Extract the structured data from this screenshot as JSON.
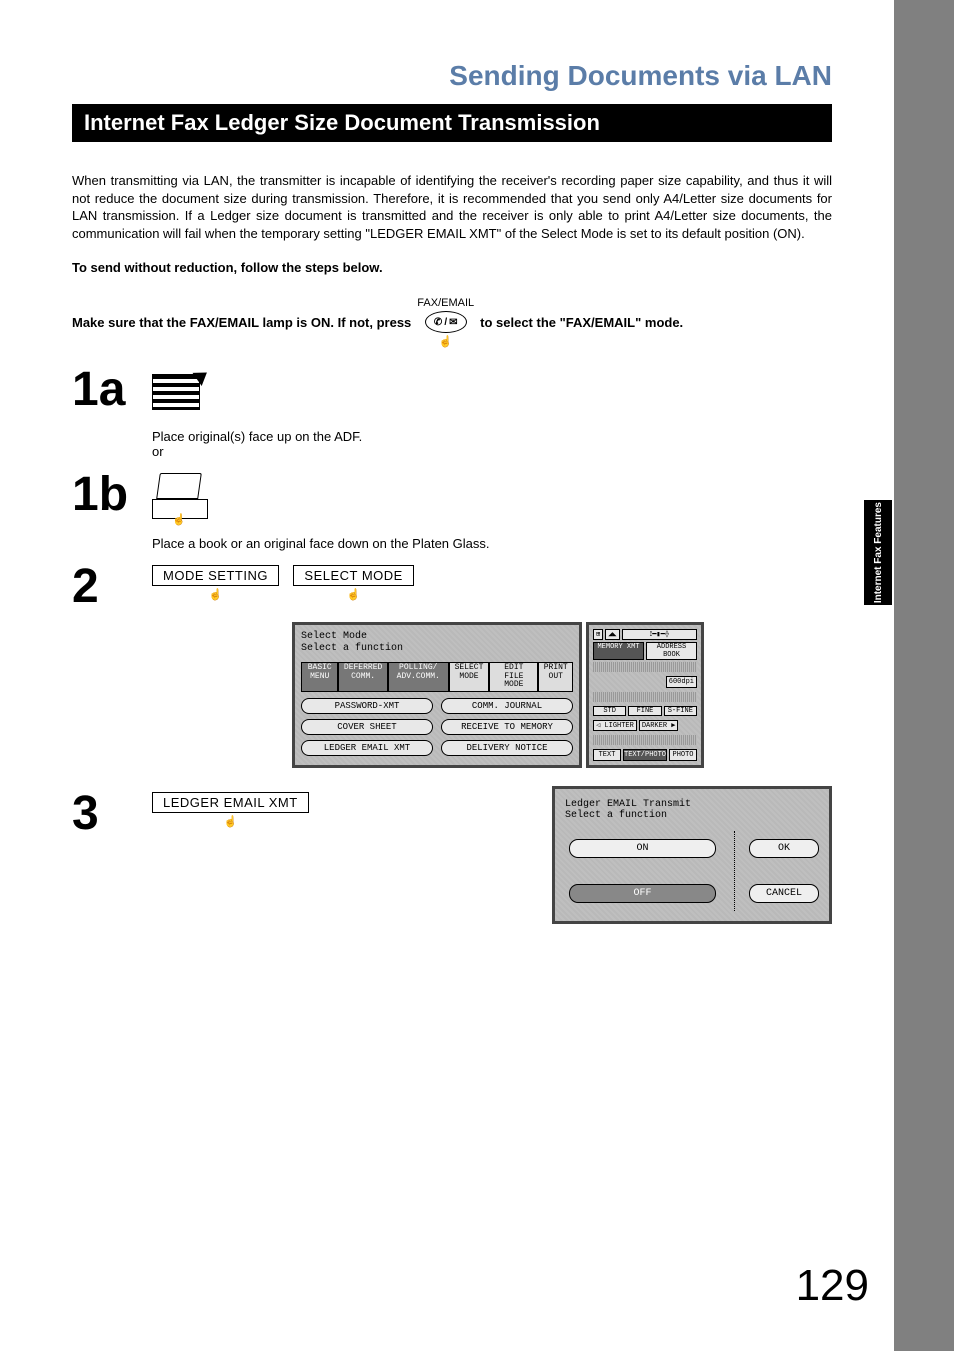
{
  "page_title": "Sending Documents via LAN",
  "section_heading": "Internet Fax Ledger Size Document Transmission",
  "side_tab": "Internet Fax\nFeatures",
  "page_number": "129",
  "intro_paragraph": "When transmitting via LAN, the transmitter is incapable of identifying the receiver's recording paper size capability, and thus it will not reduce the document size during transmission.  Therefore, it is recommended that you send only A4/Letter size documents for LAN transmission.  If a Ledger size document is transmitted and the receiver is only able to print A4/Letter size documents, the communication will fail when the temporary setting  \"LEDGER EMAIL XMT\" of the Select Mode is set to its default position (ON).",
  "bold_instruction": "To send without reduction, follow the steps below.",
  "lamp_line_pre": "Make sure that the FAX/EMAIL lamp is ON.  If not, press",
  "lamp_line_post": "to select the \"FAX/EMAIL\" mode.",
  "fax_email_label": "FAX/EMAIL",
  "steps": {
    "s1a": {
      "num": "1a",
      "text": "Place original(s) face up on the ADF.",
      "or": "or"
    },
    "s1b": {
      "num": "1b",
      "text": "Place a book or an original face down on the Platen Glass."
    },
    "s2": {
      "num": "2",
      "btn1": "MODE SETTING",
      "btn2": "SELECT MODE",
      "screen": {
        "title1": "Select Mode",
        "title2": "Select a function",
        "tabs": [
          "BASIC MENU",
          "DEFERRED COMM.",
          "POLLING/ ADV.COMM.",
          "SELECT MODE",
          "EDIT FILE MODE",
          "PRINT OUT"
        ],
        "buttons": [
          "PASSWORD-XMT",
          "COMM. JOURNAL",
          "COVER SHEET",
          "RECEIVE TO MEMORY",
          "LEDGER EMAIL XMT",
          "DELIVERY NOTICE"
        ],
        "side_top": [
          "MEMORY XMT",
          "ADDRESS BOOK"
        ],
        "dpi": "600dpi",
        "res": [
          "STD",
          "FINE",
          "S-FINE"
        ],
        "lighter": "LIGHTER",
        "darker": "DARKER",
        "orig": [
          "TEXT",
          "TEXT/PHOTO",
          "PHOTO"
        ]
      }
    },
    "s3": {
      "num": "3",
      "btn": "LEDGER EMAIL XMT",
      "screen": {
        "title1": "Ledger EMAIL Transmit",
        "title2": "Select a function",
        "on": "ON",
        "off": "OFF",
        "ok": "OK",
        "cancel": "CANCEL"
      }
    }
  }
}
